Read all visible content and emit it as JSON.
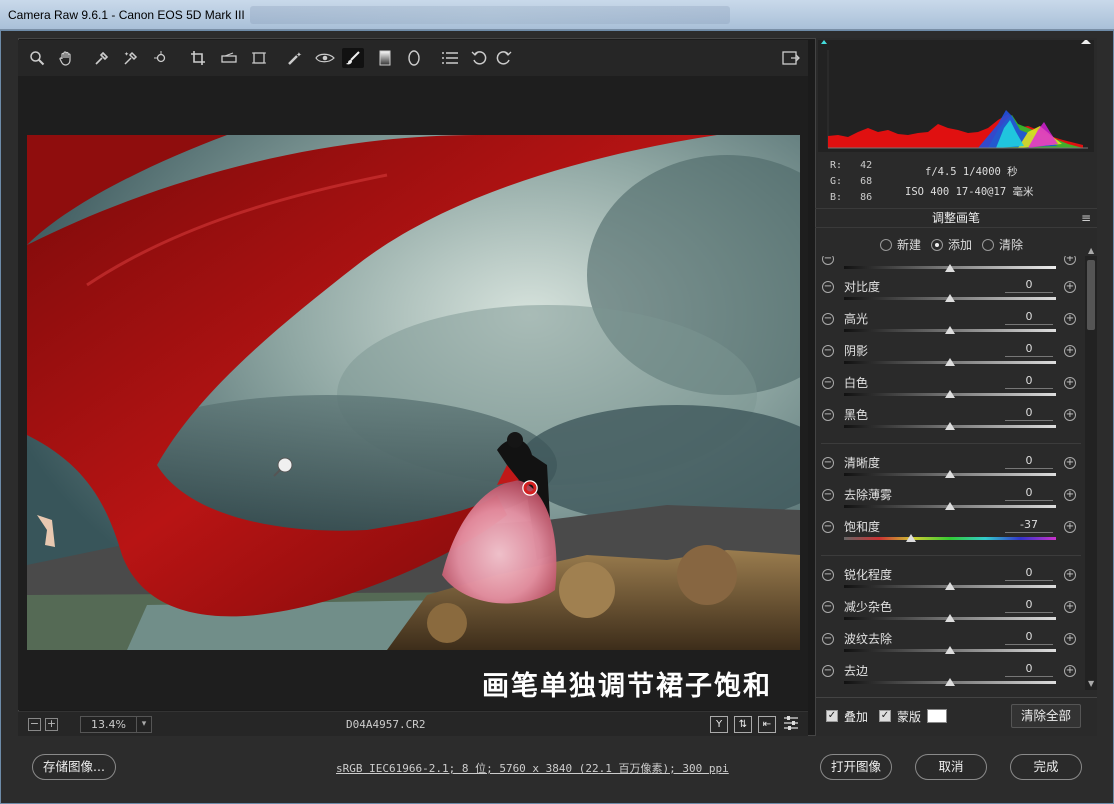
{
  "window": {
    "title": "Camera Raw 9.6.1 - Canon EOS 5D Mark III"
  },
  "canvas": {
    "caption": "画笔单独调节裙子饱和"
  },
  "zoombar": {
    "minus": "−",
    "plus": "+",
    "zoom": "13.4%",
    "filename": "D04A4957.CR2",
    "view_y": "Y"
  },
  "histogram": {
    "r_label": "R:",
    "g_label": "G:",
    "b_label": "B:",
    "r": "42",
    "g": "68",
    "b": "86"
  },
  "exif": {
    "line1": "f/4.5  1/4000 秒",
    "line2": "ISO 400  17-40@17 毫米"
  },
  "panel": {
    "title": "调整画笔",
    "mode_new": "新建",
    "mode_add": "添加",
    "mode_clear": "清除",
    "sliders": [
      {
        "label": "对比度",
        "value": "0",
        "pos": 0.5
      },
      {
        "label": "高光",
        "value": "0",
        "pos": 0.5
      },
      {
        "label": "阴影",
        "value": "0",
        "pos": 0.5
      },
      {
        "label": "白色",
        "value": "0",
        "pos": 0.5
      },
      {
        "label": "黑色",
        "value": "0",
        "pos": 0.5
      },
      {
        "label": "清晰度",
        "value": "0",
        "pos": 0.5
      },
      {
        "label": "去除薄雾",
        "value": "0",
        "pos": 0.5
      },
      {
        "label": "饱和度",
        "value": "-37",
        "pos": 0.315
      },
      {
        "label": "锐化程度",
        "value": "0",
        "pos": 0.5
      },
      {
        "label": "减少杂色",
        "value": "0",
        "pos": 0.5
      },
      {
        "label": "波纹去除",
        "value": "0",
        "pos": 0.5
      },
      {
        "label": "去边",
        "value": "0",
        "pos": 0.5
      }
    ],
    "overlay_label": "叠加",
    "mask_label": "蒙版",
    "clear_all": "清除全部"
  },
  "footer": {
    "save": "存储图像...",
    "status": "sRGB IEC61966-2.1; 8 位; 5760 x 3840 (22.1 百万像素); 300 ppi",
    "open": "打开图像",
    "cancel": "取消",
    "done": "完成"
  }
}
